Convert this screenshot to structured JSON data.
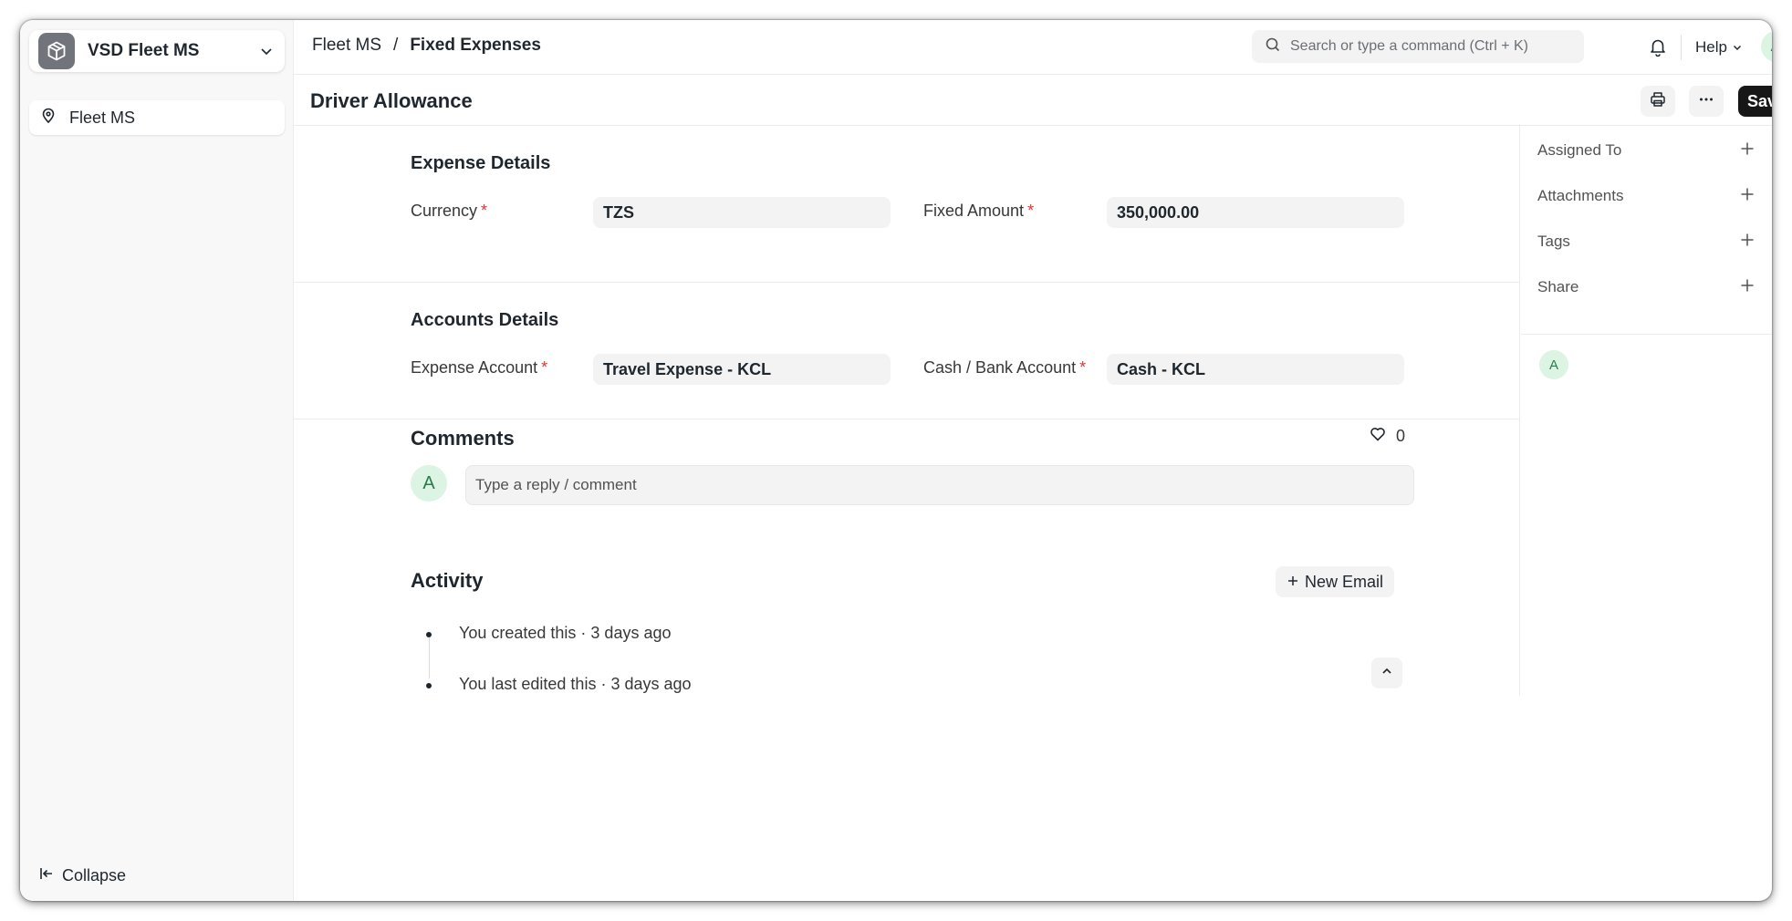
{
  "sidebar": {
    "app_name": "VSD Fleet MS",
    "items": [
      {
        "label": "Fleet MS",
        "icon": "map-pin-icon"
      }
    ],
    "collapse_label": "Collapse"
  },
  "navbar": {
    "breadcrumb": [
      "Fleet MS",
      "Fixed Expenses"
    ],
    "breadcrumb_separator": "/",
    "search_placeholder": "Search or type a command (Ctrl + K)",
    "help_label": "Help",
    "avatar_initial": "A"
  },
  "page": {
    "title": "Driver Allowance",
    "save_label": "Save"
  },
  "sections": {
    "expense": {
      "title": "Expense Details",
      "currency_label": "Currency",
      "currency_value": "TZS",
      "amount_label": "Fixed Amount",
      "amount_value": "350,000.00"
    },
    "accounts": {
      "title": "Accounts Details",
      "expense_account_label": "Expense Account",
      "expense_account_value": "Travel Expense - KCL",
      "cash_account_label": "Cash / Bank Account",
      "cash_account_value": "Cash - KCL"
    },
    "required_mark": "*"
  },
  "comments": {
    "title": "Comments",
    "like_count": "0",
    "avatar_initial": "A",
    "placeholder": "Type a reply / comment"
  },
  "activity": {
    "title": "Activity",
    "new_email_label": "New Email",
    "items": [
      {
        "text": "You created this · 3 days ago"
      },
      {
        "text": "You last edited this · 3 days ago"
      }
    ]
  },
  "rightbar": {
    "items": [
      {
        "label": "Assigned To"
      },
      {
        "label": "Attachments"
      },
      {
        "label": "Tags"
      },
      {
        "label": "Share"
      }
    ],
    "avatar_initial": "A"
  },
  "colors": {
    "primary_button": "#171717",
    "required": "#e03636",
    "avatar_bg": "#dcf4e3",
    "avatar_text": "#2c7a4a"
  }
}
